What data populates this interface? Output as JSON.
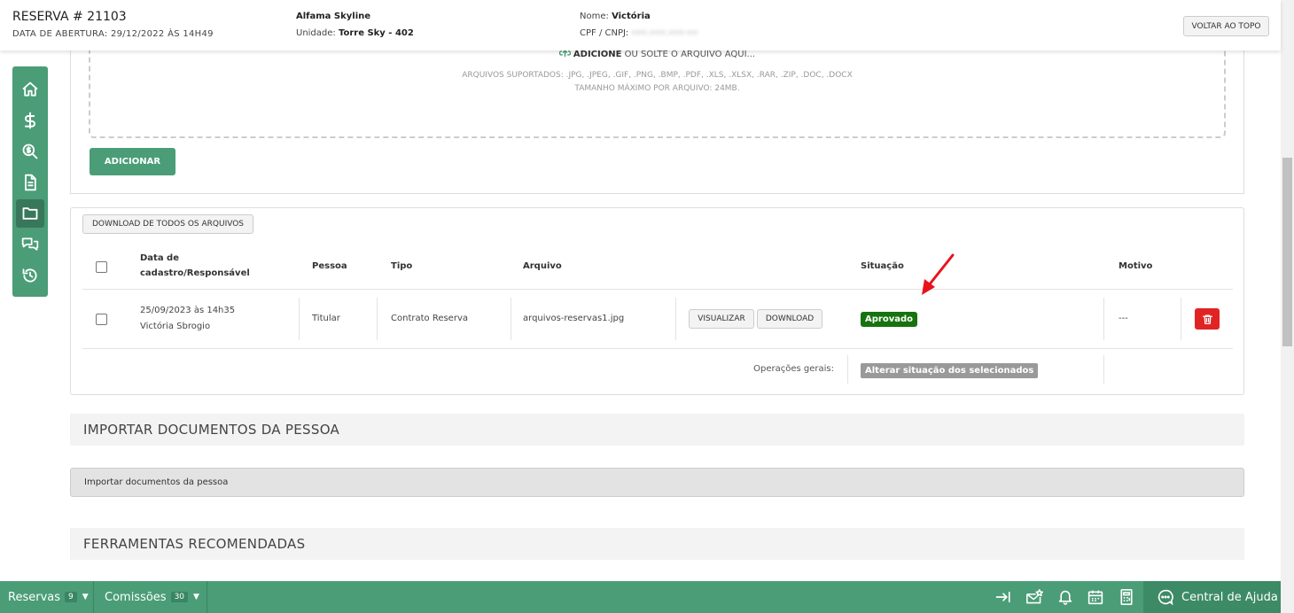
{
  "header": {
    "title": "RESERVA # 21103",
    "opening_date": "DATA DE ABERTURA: 29/12/2022 ÀS 14H49",
    "project": "Alfama Skyline",
    "unit_label": "Unidade:",
    "unit_value": "Torre Sky - 402",
    "name_label": "Nome:",
    "name_value": "Victória",
    "cpf_label": "CPF / CNPJ:",
    "cpf_value": "•••.•••.•••-••",
    "back_to_top": "VOLTAR AO TOPO"
  },
  "sidenav": {
    "items": [
      {
        "icon": "home-icon"
      },
      {
        "icon": "dollar-icon"
      },
      {
        "icon": "search-dollar-icon"
      },
      {
        "icon": "document-icon"
      },
      {
        "icon": "folder-icon",
        "active": true
      },
      {
        "icon": "chat-icon"
      },
      {
        "icon": "history-icon"
      }
    ]
  },
  "upload": {
    "drop_strong": "ADICIONE",
    "drop_rest": " OU SOLTE O ARQUIVO AQUI...",
    "supported": "ARQUIVOS SUPORTADOS: .JPG, .JPEG, .GIF, .PNG, .BMP, .PDF, .XLS, .XLSX, .RAR, .ZIP, .DOC, .DOCX",
    "max_size": "TAMANHO MÁXIMO POR ARQUIVO: 24MB.",
    "add_button": "ADICIONAR"
  },
  "files": {
    "download_all": "DOWNLOAD DE TODOS OS ARQUIVOS",
    "columns": {
      "date_line1": "Data de",
      "date_line2": "cadastro/Responsável",
      "person": "Pessoa",
      "type": "Tipo",
      "file": "Arquivo",
      "status": "Situação",
      "reason": "Motivo"
    },
    "rows": [
      {
        "date": "25/09/2023 às 14h35",
        "responsible": "Victória Sbrogio",
        "person": "Titular",
        "type": "Contrato Reserva",
        "file": "arquivos-reservas1.jpg",
        "view_button": "VISUALIZAR",
        "download_button": "DOWNLOAD",
        "status": "Aprovado",
        "reason": "---"
      }
    ],
    "general_ops_label": "Operações gerais:",
    "change_status_button": "Alterar situação dos selecionados"
  },
  "sections": {
    "import_title": "IMPORTAR DOCUMENTOS DA PESSOA",
    "import_bar": "Importar documentos da pessoa",
    "tools_title": "FERRAMENTAS RECOMENDADAS"
  },
  "bottombar": {
    "reservas_label": "Reservas",
    "reservas_count": "9",
    "comissoes_label": "Comissões",
    "comissoes_count": "30",
    "help_label": "Central de Ajuda"
  },
  "colors": {
    "brand_green": "#4a9d77",
    "approved_green": "#16730e",
    "danger_red": "#e02424",
    "annotation_arrow": "#e8141c"
  }
}
